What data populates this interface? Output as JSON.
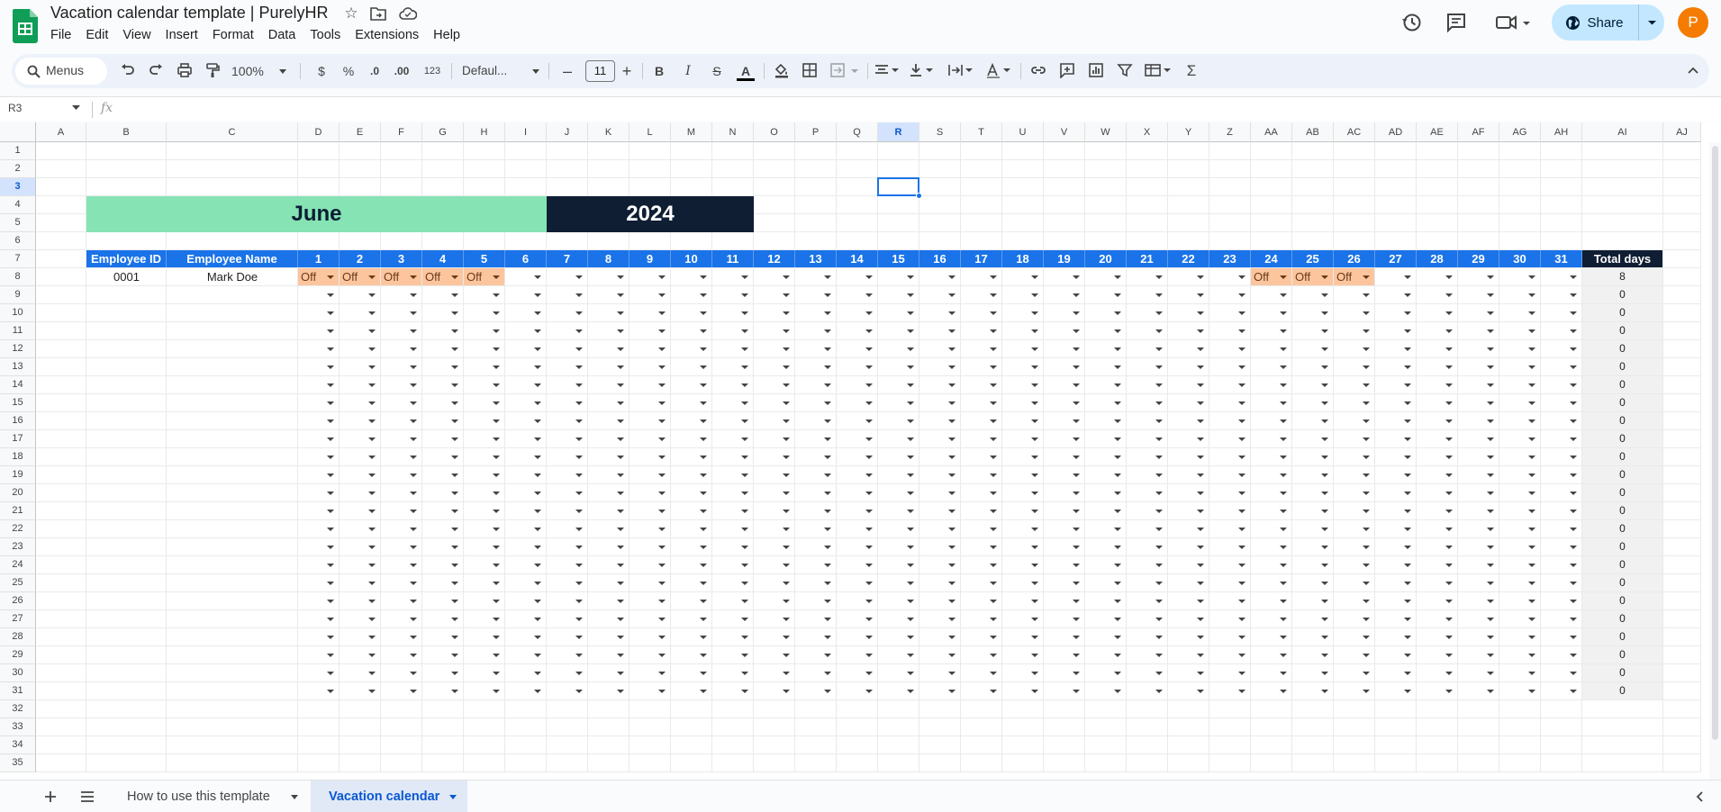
{
  "doc": {
    "title": "Vacation calendar template | PurelyHR"
  },
  "menu": [
    "File",
    "Edit",
    "View",
    "Insert",
    "Format",
    "Data",
    "Tools",
    "Extensions",
    "Help"
  ],
  "header": {
    "share_label": "Share",
    "avatar_initial": "P"
  },
  "toolbar": {
    "menus_label": "Menus",
    "zoom": "100%",
    "currency": "$",
    "percent": "%",
    "dec_decrease": ".0",
    "dec_increase": ".00",
    "number_format": "123",
    "font": "Defaul...",
    "font_size": "11",
    "bold": "B",
    "italic": "I",
    "strike": "S",
    "text_color": "A",
    "sum": "Σ"
  },
  "formula_bar": {
    "cell_ref": "R3",
    "fx": "fx"
  },
  "sheet": {
    "columns": [
      "A",
      "B",
      "C",
      "D",
      "E",
      "F",
      "G",
      "H",
      "I",
      "J",
      "K",
      "L",
      "M",
      "N",
      "O",
      "P",
      "Q",
      "R",
      "S",
      "T",
      "U",
      "V",
      "W",
      "X",
      "Y",
      "Z",
      "AA",
      "AB",
      "AC",
      "AD",
      "AE",
      "AF",
      "AG",
      "AH",
      "AI",
      "AJ"
    ],
    "selected_column": "R",
    "rows": [
      "1",
      "2",
      "3",
      "4",
      "5",
      "6",
      "7",
      "8",
      "9",
      "10",
      "11",
      "12",
      "13",
      "14",
      "15",
      "16",
      "17",
      "18",
      "19",
      "20",
      "21",
      "22",
      "23",
      "24",
      "25",
      "26",
      "27",
      "28",
      "29",
      "30",
      "31",
      "32",
      "33",
      "34",
      "35"
    ],
    "selected_row": "3",
    "month": "June",
    "year": "2024",
    "table_headers": {
      "employee_id": "Employee ID",
      "employee_name": "Employee Name",
      "days": [
        "1",
        "2",
        "3",
        "4",
        "5",
        "6",
        "7",
        "8",
        "9",
        "10",
        "11",
        "12",
        "13",
        "14",
        "15",
        "16",
        "17",
        "18",
        "19",
        "20",
        "21",
        "22",
        "23",
        "24",
        "25",
        "26",
        "27",
        "28",
        "29",
        "30",
        "31"
      ],
      "total": "Total days"
    },
    "employees": [
      {
        "id": "0001",
        "name": "Mark Doe",
        "off_days": [
          1,
          2,
          3,
          4,
          5,
          24,
          25,
          26
        ],
        "off_label": "Off",
        "total": "8"
      }
    ],
    "empty_row_total": "0",
    "empty_row_count": 23
  },
  "tabs": [
    {
      "label": "How to use this template",
      "active": false
    },
    {
      "label": "Vacation calendar",
      "active": true
    }
  ],
  "colors": {
    "header_blue": "#1a73e8",
    "month_green": "#86e3b4",
    "year_navy": "#0f1e33",
    "off_orange": "#fcc59e",
    "selection": "#1a73e8"
  }
}
